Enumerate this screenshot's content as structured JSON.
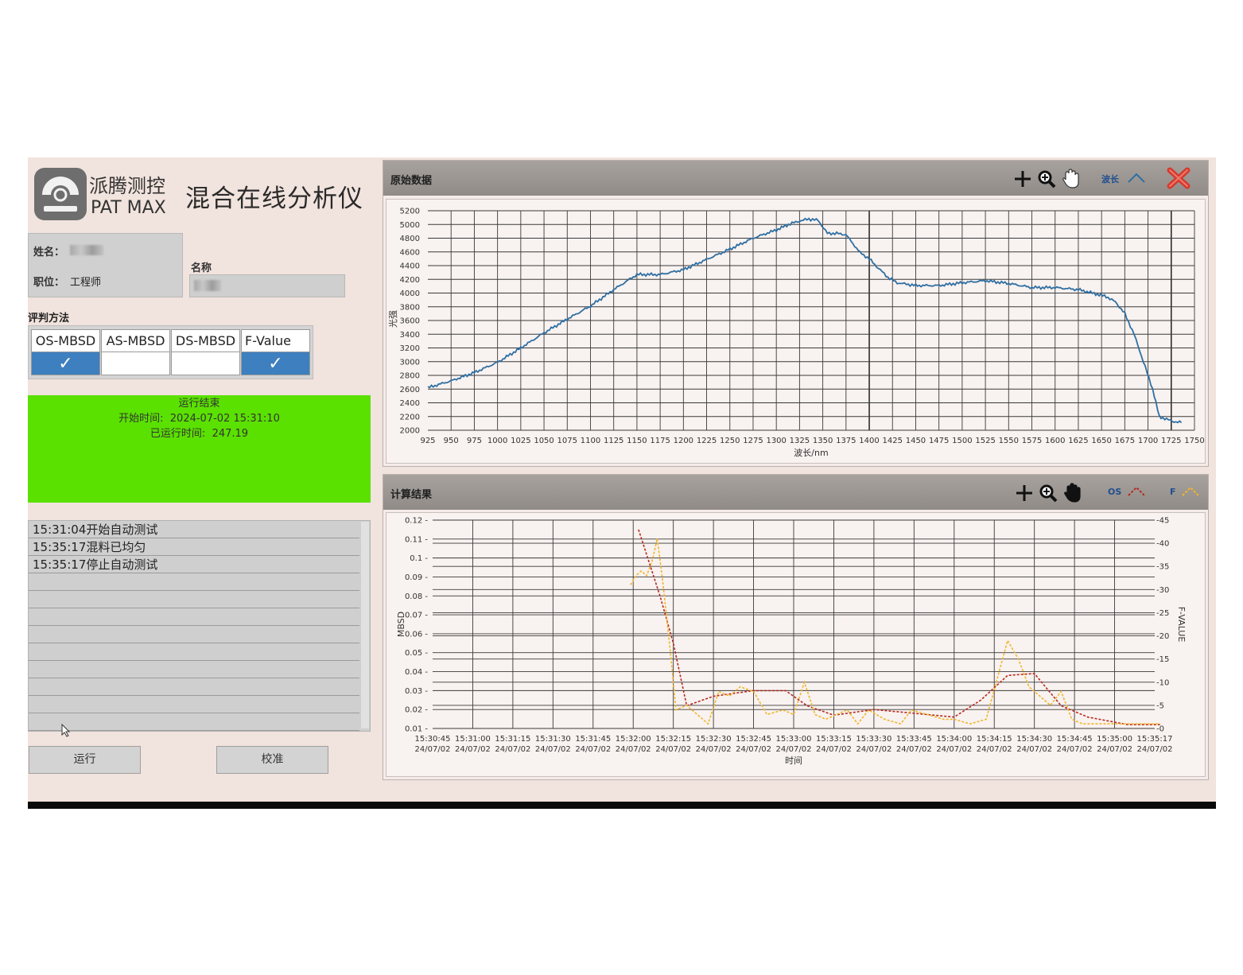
{
  "brand": {
    "cn": "派腾测控",
    "en": "PAT MAX"
  },
  "app_title": "混合在线分析仪",
  "user": {
    "name_label": "姓名：",
    "role_label": "职位：",
    "role_value": "工程师",
    "name_field_label": "名称"
  },
  "method": {
    "title": "评判方法",
    "options": [
      {
        "label": "OS-MBSD",
        "checked": true
      },
      {
        "label": "AS-MBSD",
        "checked": false
      },
      {
        "label": "DS-MBSD",
        "checked": false
      },
      {
        "label": "F-Value",
        "checked": true
      }
    ],
    "check_glyph": "✓"
  },
  "status": {
    "title": "运行结束",
    "start_label": "开始时间:",
    "start_value": "2024-07-02 15:31:10",
    "elapsed_label": "已运行时间:",
    "elapsed_value": "247.19",
    "color": "#5ae100"
  },
  "log": [
    "15:31:04开始自动测试",
    "15:35:17混料已均匀",
    "15:35:17停止自动测试"
  ],
  "buttons": {
    "run": "运行",
    "calibrate": "校准"
  },
  "colors": {
    "spectrum": "#2f6fa3",
    "os": "#b52a1f",
    "f": "#f1b52a"
  },
  "spectrum_panel": {
    "title": "原始数据",
    "legend": "波长",
    "tools": [
      "crosshair-icon",
      "zoom-icon",
      "pan-hand-icon"
    ],
    "chart_data": {
      "type": "line",
      "xlabel": "波长/nm",
      "ylabel": "光强",
      "xlim": [
        925,
        1750
      ],
      "ylim": [
        2000,
        5200
      ],
      "x_ticks": [
        925,
        950,
        975,
        1000,
        1025,
        1050,
        1075,
        1100,
        1125,
        1150,
        1175,
        1200,
        1225,
        1250,
        1275,
        1300,
        1325,
        1350,
        1375,
        1400,
        1425,
        1450,
        1475,
        1500,
        1525,
        1550,
        1575,
        1600,
        1625,
        1650,
        1675,
        1700,
        1725,
        1750
      ],
      "y_ticks": [
        2000,
        2200,
        2400,
        2600,
        2800,
        3000,
        3200,
        3400,
        3600,
        3800,
        4000,
        4200,
        4400,
        4600,
        4800,
        5000,
        5200
      ],
      "series": [
        {
          "x": [
            925,
            950,
            975,
            1000,
            1025,
            1050,
            1075,
            1100,
            1125,
            1150,
            1175,
            1200,
            1225,
            1250,
            1275,
            1300,
            1315,
            1325,
            1335,
            1345,
            1355,
            1365,
            1375,
            1390,
            1400,
            1410,
            1420,
            1430,
            1450,
            1475,
            1500,
            1525,
            1550,
            1575,
            1600,
            1625,
            1640,
            1655,
            1665,
            1675,
            1685,
            1695,
            1705,
            1712,
            1722,
            1730,
            1736
          ],
          "y": [
            2620,
            2720,
            2840,
            2990,
            3200,
            3420,
            3620,
            3810,
            4050,
            4270,
            4270,
            4340,
            4490,
            4640,
            4800,
            4920,
            5010,
            5050,
            5080,
            5060,
            4870,
            4870,
            4850,
            4590,
            4500,
            4360,
            4230,
            4150,
            4110,
            4110,
            4150,
            4180,
            4140,
            4080,
            4080,
            4050,
            4000,
            3950,
            3870,
            3700,
            3400,
            3000,
            2600,
            2200,
            2150,
            2120,
            2110
          ]
        }
      ]
    }
  },
  "result_panel": {
    "title": "计算结果",
    "legend_os": "OS",
    "legend_f": "F",
    "tools": [
      "crosshair-icon",
      "zoom-icon",
      "pan-hand-icon"
    ],
    "chart_data": {
      "type": "line",
      "xlabel": "时间",
      "ylabel": "MBSD",
      "y2label": "F-VALUE",
      "ylim": [
        0.01,
        0.12
      ],
      "y2lim": [
        0,
        45
      ],
      "y_ticks": [
        0.01,
        0.02,
        0.03,
        0.04,
        0.05,
        0.06,
        0.07,
        0.08,
        0.09,
        0.1,
        0.11,
        0.12
      ],
      "y2_ticks": [
        0,
        5,
        10,
        15,
        20,
        25,
        30,
        35,
        40,
        45
      ],
      "x_ticks": [
        [
          "15:30:45",
          "24/07/02"
        ],
        [
          "15:31:00",
          "24/07/02"
        ],
        [
          "15:31:15",
          "24/07/02"
        ],
        [
          "15:31:30",
          "24/07/02"
        ],
        [
          "15:31:45",
          "24/07/02"
        ],
        [
          "15:32:00",
          "24/07/02"
        ],
        [
          "15:32:15",
          "24/07/02"
        ],
        [
          "15:32:30",
          "24/07/02"
        ],
        [
          "15:32:45",
          "24/07/02"
        ],
        [
          "15:33:00",
          "24/07/02"
        ],
        [
          "15:33:15",
          "24/07/02"
        ],
        [
          "15:33:30",
          "24/07/02"
        ],
        [
          "15:33:45",
          "24/07/02"
        ],
        [
          "15:34:00",
          "24/07/02"
        ],
        [
          "15:34:15",
          "24/07/02"
        ],
        [
          "15:34:30",
          "24/07/02"
        ],
        [
          "15:34:45",
          "24/07/02"
        ],
        [
          "15:35:00",
          "24/07/02"
        ],
        [
          "15:35:17",
          "24/07/02"
        ]
      ],
      "series": [
        {
          "name": "OS",
          "x": [
            "15:32:02",
            "15:32:10",
            "15:32:15",
            "15:32:20",
            "15:32:30",
            "15:32:45",
            "15:32:57",
            "15:33:05",
            "15:33:15",
            "15:33:30",
            "15:33:45",
            "15:34:00",
            "15:34:10",
            "15:34:20",
            "15:34:30",
            "15:34:40",
            "15:34:50",
            "15:35:05",
            "15:35:17"
          ],
          "y": [
            0.115,
            0.08,
            0.055,
            0.022,
            0.027,
            0.03,
            0.03,
            0.022,
            0.017,
            0.02,
            0.018,
            0.016,
            0.025,
            0.038,
            0.039,
            0.022,
            0.016,
            0.012,
            0.012
          ]
        },
        {
          "name": "F",
          "x": [
            "15:31:59",
            "15:32:01",
            "15:32:03",
            "15:32:05",
            "15:32:07",
            "15:32:09",
            "15:32:11",
            "15:32:14",
            "15:32:16",
            "15:32:20",
            "15:32:24",
            "15:32:28",
            "15:32:32",
            "15:32:36",
            "15:32:40",
            "15:32:45",
            "15:32:50",
            "15:32:56",
            "15:33:00",
            "15:33:04",
            "15:33:08",
            "15:33:12",
            "15:33:16",
            "15:33:20",
            "15:33:24",
            "15:33:28",
            "15:33:34",
            "15:33:40",
            "15:33:44",
            "15:33:50",
            "15:33:56",
            "15:34:00",
            "15:34:06",
            "15:34:12",
            "15:34:20",
            "15:34:24",
            "15:34:28",
            "15:34:32",
            "15:34:36",
            "15:34:40",
            "15:34:44",
            "15:34:48",
            "15:34:56",
            "15:35:04",
            "15:35:17"
          ],
          "y": [
            31,
            33,
            34,
            33,
            36,
            41,
            32,
            16,
            4,
            5,
            3,
            1,
            8,
            7,
            9,
            8,
            3,
            4,
            3,
            10,
            3,
            2,
            3,
            4,
            1,
            4,
            2,
            1,
            4,
            3,
            2,
            2,
            1,
            2,
            19,
            15,
            9,
            7,
            5,
            8,
            2,
            1,
            1,
            1,
            1
          ]
        }
      ]
    }
  }
}
